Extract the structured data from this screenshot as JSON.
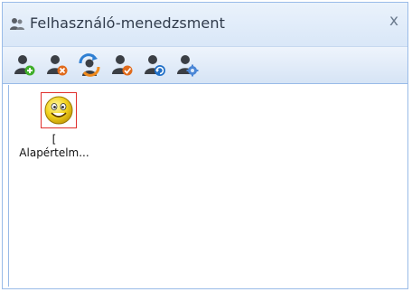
{
  "window": {
    "title": "Felhasználó-menedzsment",
    "title_icon": "users-icon",
    "close_label": "x"
  },
  "toolbar": {
    "items": [
      {
        "name": "add-user",
        "icon": "user-add-icon"
      },
      {
        "name": "delete-user",
        "icon": "user-delete-icon"
      },
      {
        "name": "switch-user",
        "icon": "user-switch-icon"
      },
      {
        "name": "confirm-user",
        "icon": "user-check-icon"
      },
      {
        "name": "refresh-user",
        "icon": "user-refresh-icon"
      },
      {
        "name": "user-settings",
        "icon": "user-settings-icon"
      }
    ]
  },
  "users": [
    {
      "line1": "[",
      "line2": "Alapértelm...",
      "icon": "smiley-avatar-icon",
      "selected": true
    }
  ],
  "colors": {
    "border": "#99bbe8",
    "selection": "#e0302c",
    "user_silhouette": "#3b3f45"
  }
}
